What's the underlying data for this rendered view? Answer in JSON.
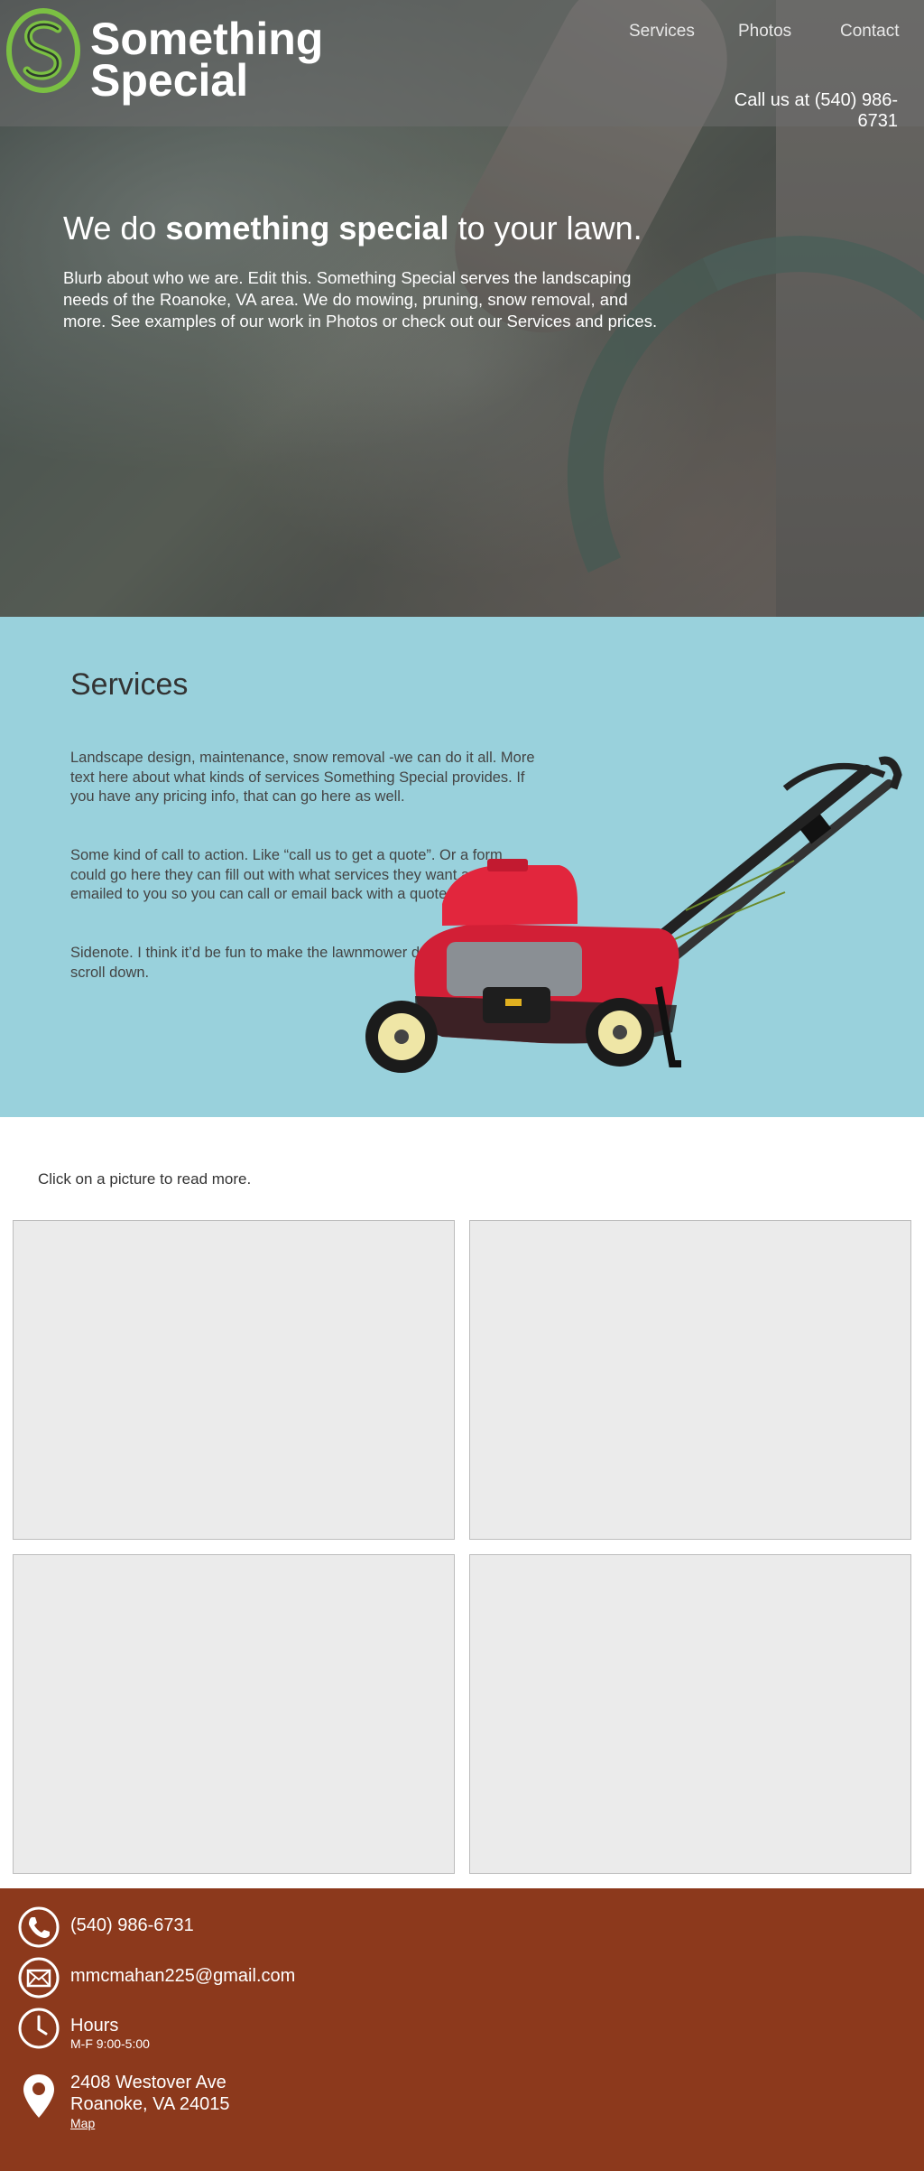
{
  "brand": {
    "line1": "Something",
    "line2": "Special"
  },
  "nav": {
    "services": "Services",
    "photos": "Photos",
    "contact": "Contact"
  },
  "call_us": "Call us at (540) 986-6731",
  "hero": {
    "title_pre": "We do ",
    "title_bold": "something special",
    "title_post": " to your lawn.",
    "blurb": "Blurb about who we are. Edit this. Something Special serves the landscaping needs of the Roanoke, VA area. We do mowing, pruning, snow removal, and more. See examples of our work in Photos or check out our Services and prices."
  },
  "services": {
    "heading": "Services",
    "p1": "Landscape design, maintenance, snow removal -we can do it all. More text here about what kinds of services Something Special provides. If you have any pricing info, that can go here as well.",
    "p2": "Some kind of call to action. Like “call us to get a quote”. Or a form could go here they can fill out with what services they want and it gets emailed to you so you can call or email back with a quote.",
    "p3": "Sidenote. I think it’d be fun to make the lawnmower drive by as you scroll down."
  },
  "photos": {
    "hint": "Click on a picture to read more."
  },
  "footer": {
    "phone": "(540) 986-6731",
    "email": "mmcmahan225@gmail.com",
    "hours_label": "Hours",
    "hours_value": "M-F 9:00-5:00",
    "address_line1": "2408 Westover Ave",
    "address_line2": "Roanoke, VA 24015",
    "map_link": "Map"
  },
  "colors": {
    "services_bg": "#99d1dc",
    "footer_bg": "#8c391c",
    "logo_green": "#7bc043",
    "tile_bg": "#ebebeb"
  }
}
